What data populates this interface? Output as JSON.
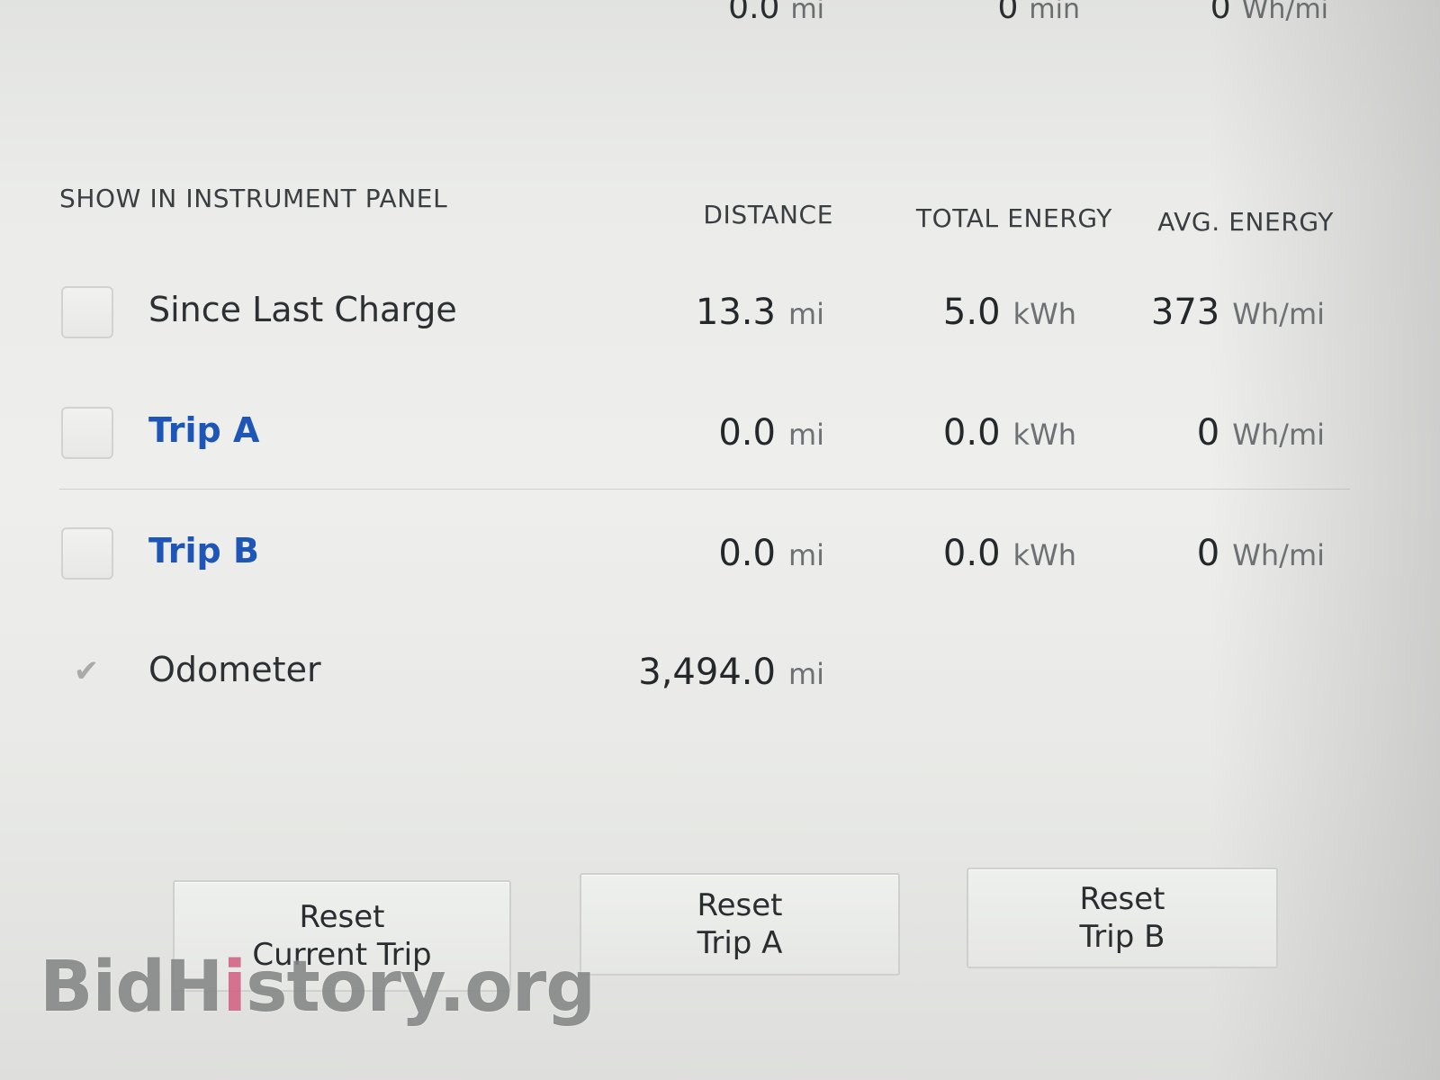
{
  "top_row": {
    "distance": "0.0",
    "distance_unit": "mi",
    "time": "0",
    "time_unit": "min",
    "avg": "0",
    "avg_unit": "Wh/mi"
  },
  "headers": {
    "show": "SHOW IN INSTRUMENT PANEL",
    "distance": "DISTANCE",
    "total_energy": "TOTAL ENERGY",
    "avg_energy": "AVG. ENERGY"
  },
  "rows": [
    {
      "label": "Since Last Charge",
      "checked": false,
      "distance": "13.3",
      "distance_unit": "mi",
      "energy": "5.0",
      "energy_unit": "kWh",
      "avg": "373",
      "avg_unit": "Wh/mi"
    },
    {
      "label": "Trip A",
      "checked": false,
      "distance": "0.0",
      "distance_unit": "mi",
      "energy": "0.0",
      "energy_unit": "kWh",
      "avg": "0",
      "avg_unit": "Wh/mi"
    },
    {
      "label": "Trip B",
      "checked": false,
      "distance": "0.0",
      "distance_unit": "mi",
      "energy": "0.0",
      "energy_unit": "kWh",
      "avg": "0",
      "avg_unit": "Wh/mi"
    }
  ],
  "odometer": {
    "label": "Odometer",
    "checked": true,
    "check_icon": "checkmark-icon",
    "value": "3,494.0",
    "unit": "mi"
  },
  "buttons": {
    "reset_current": [
      "Reset",
      "Current Trip"
    ],
    "reset_a": [
      "Reset",
      "Trip A"
    ],
    "reset_b": [
      "Reset",
      "Trip B"
    ]
  },
  "watermark": {
    "part1": "Bid",
    "part2": "H",
    "part3": "i",
    "part4": "story.org"
  },
  "colors": {
    "trip_label_blue": "#1e56b8",
    "text_dark": "#2a2d30",
    "unit_gray": "#6e7174"
  }
}
